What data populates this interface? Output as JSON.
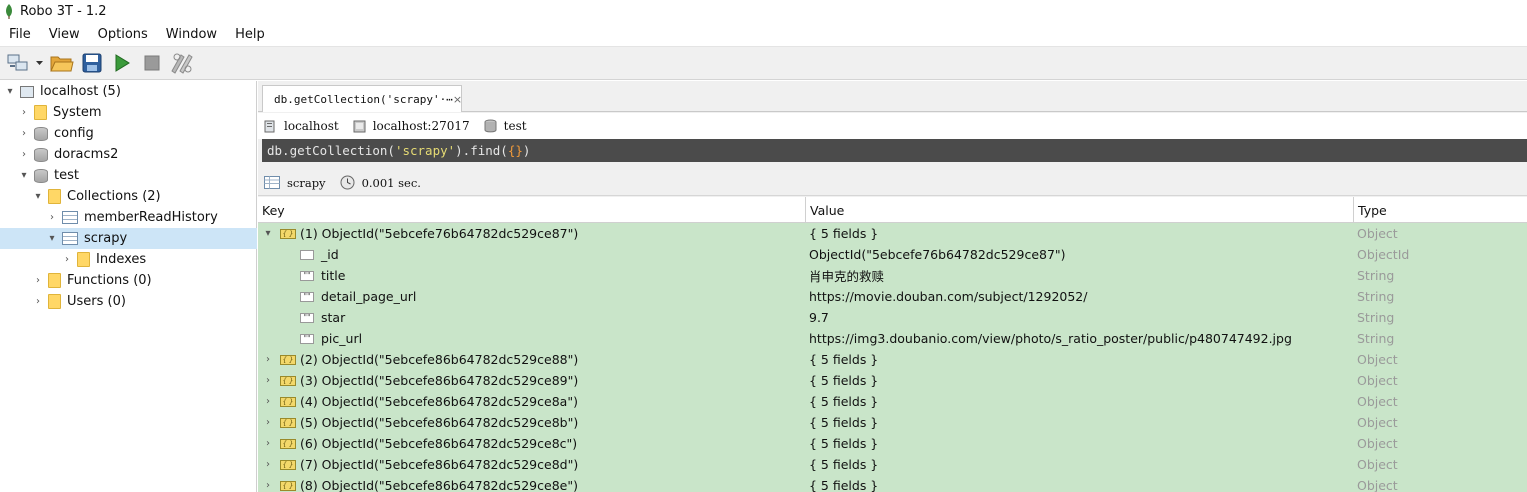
{
  "window": {
    "title": "Robo 3T - 1.2"
  },
  "menu": [
    "File",
    "View",
    "Options",
    "Window",
    "Help"
  ],
  "toolbar": {
    "buttons": [
      "connect-icon",
      "dropdown-arrow-icon",
      "open-folder-icon",
      "save-icon",
      "run-icon",
      "stop-icon",
      "rotate-icon"
    ]
  },
  "sidebar": {
    "items": [
      {
        "label": "localhost (5)",
        "icon": "server-icon",
        "arrow": "▾"
      },
      {
        "label": "System",
        "icon": "folder-icon",
        "arrow": "›"
      },
      {
        "label": "config",
        "icon": "database-icon",
        "arrow": "›"
      },
      {
        "label": "doracms2",
        "icon": "database-icon",
        "arrow": "›"
      },
      {
        "label": "test",
        "icon": "database-icon",
        "arrow": "▾"
      },
      {
        "label": "Collections (2)",
        "icon": "folder-icon",
        "arrow": "▾"
      },
      {
        "label": "memberReadHistory",
        "icon": "collection-icon",
        "arrow": "›"
      },
      {
        "label": "scrapy",
        "icon": "collection-icon",
        "arrow": "▾"
      },
      {
        "label": "Indexes",
        "icon": "folder-icon",
        "arrow": "›"
      },
      {
        "label": "Functions (0)",
        "icon": "folder-icon",
        "arrow": "›"
      },
      {
        "label": "Users (0)",
        "icon": "folder-icon",
        "arrow": "›"
      }
    ]
  },
  "tab": {
    "label": "db.getCollection('scrapy'·⋯",
    "close": "×"
  },
  "connection": {
    "server": "localhost",
    "address": "localhost:27017",
    "database": "test"
  },
  "query": {
    "prefix": "db.getCollection(",
    "string": "'scrapy'",
    "suffix": ").find(",
    "braces": "{}",
    "end": ")"
  },
  "result": {
    "collection": "scrapy",
    "time": "0.001 sec."
  },
  "grid": {
    "columns": [
      "Key",
      "Value",
      "Type"
    ],
    "rows": [
      {
        "key": "(1) ObjectId(\"5ebcefe76b64782dc529ce87\")",
        "value": "{ 5 fields }",
        "type": "Object",
        "arrow": "▾",
        "icon": "O"
      },
      {
        "key": "_id",
        "value": "ObjectId(\"5ebcefe76b64782dc529ce87\")",
        "type": "ObjectId",
        "arrow": "",
        "icon": "id"
      },
      {
        "key": "title",
        "value": "肖申克的救赎",
        "type": "String",
        "arrow": "",
        "icon": "\"\""
      },
      {
        "key": "detail_page_url",
        "value": "https://movie.douban.com/subject/1292052/",
        "type": "String",
        "arrow": "",
        "icon": "\"\""
      },
      {
        "key": "star",
        "value": "9.7",
        "type": "String",
        "arrow": "",
        "icon": "\"\""
      },
      {
        "key": "pic_url",
        "value": "https://img3.doubanio.com/view/photo/s_ratio_poster/public/p480747492.jpg",
        "type": "String",
        "arrow": "",
        "icon": "\"\""
      },
      {
        "key": "(2) ObjectId(\"5ebcefe86b64782dc529ce88\")",
        "value": "{ 5 fields }",
        "type": "Object",
        "arrow": "›",
        "icon": "O"
      },
      {
        "key": "(3) ObjectId(\"5ebcefe86b64782dc529ce89\")",
        "value": "{ 5 fields }",
        "type": "Object",
        "arrow": "›",
        "icon": "O"
      },
      {
        "key": "(4) ObjectId(\"5ebcefe86b64782dc529ce8a\")",
        "value": "{ 5 fields }",
        "type": "Object",
        "arrow": "›",
        "icon": "O"
      },
      {
        "key": "(5) ObjectId(\"5ebcefe86b64782dc529ce8b\")",
        "value": "{ 5 fields }",
        "type": "Object",
        "arrow": "›",
        "icon": "O"
      },
      {
        "key": "(6) ObjectId(\"5ebcefe86b64782dc529ce8c\")",
        "value": "{ 5 fields }",
        "type": "Object",
        "arrow": "›",
        "icon": "O"
      },
      {
        "key": "(7) ObjectId(\"5ebcefe86b64782dc529ce8d\")",
        "value": "{ 5 fields }",
        "type": "Object",
        "arrow": "›",
        "icon": "O"
      },
      {
        "key": "(8) ObjectId(\"5ebcefe86b64782dc529ce8e\")",
        "value": "{ 5 fields }",
        "type": "Object",
        "arrow": "›",
        "icon": "O"
      }
    ]
  }
}
